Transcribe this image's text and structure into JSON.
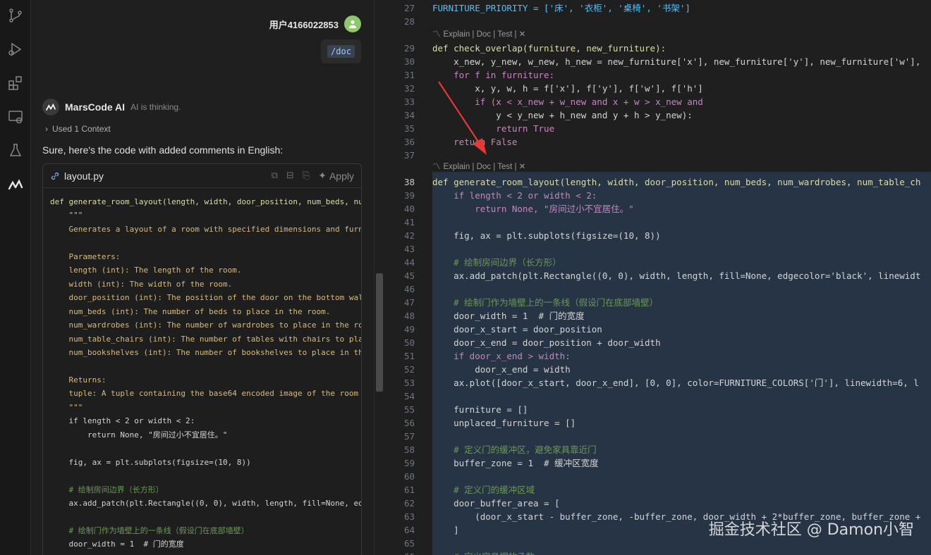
{
  "chat": {
    "user_name": "用户4166022853",
    "command": "/doc",
    "ai_name": "MarsCode AI",
    "ai_status": "AI is thinking.",
    "context_label": "Used 1 Context",
    "intro_text": "Sure, here's the code with added comments in English:",
    "code_card": {
      "file_name": "layout.py",
      "apply_label": "Apply",
      "lines": [
        "def generate_room_layout(length, width, door_position, num_beds, nu",
        "    \"\"\"",
        "    Generates a layout of a room with specified dimensions and furn",
        "",
        "    Parameters:",
        "    length (int): The length of the room.",
        "    width (int): The width of the room.",
        "    door_position (int): The position of the door on the bottom wal",
        "    num_beds (int): The number of beds to place in the room.",
        "    num_wardrobes (int): The number of wardrobes to place in the ro",
        "    num_table_chairs (int): The number of tables with chairs to pla",
        "    num_bookshelves (int): The number of bookshelves to place in th",
        "",
        "    Returns:",
        "    tuple: A tuple containing the base64 encoded image of the room",
        "    \"\"\"",
        "    if length < 2 or width < 2:",
        "        return None, \"房间过小不宜居住。\"",
        "",
        "    fig, ax = plt.subplots(figsize=(10, 8))",
        "",
        "    # 绘制房间边界（长方形）",
        "    ax.add_patch(plt.Rectangle((0, 0), width, length, fill=None, ed",
        "",
        "    # 绘制门作为墙壁上的一条线（假设门在底部墙壁）",
        "    door_width = 1  # 门的宽度"
      ]
    }
  },
  "editor": {
    "lens_label": "Explain | Doc | Test | ✕",
    "lines": [
      {
        "n": "27",
        "text": "FURNITURE_PRIORITY = ['床', '衣柜', '桌椅', '书架']"
      },
      {
        "n": "28",
        "text": ""
      },
      {
        "n": "29",
        "text": "def check_overlap(furniture, new_furniture):"
      },
      {
        "n": "30",
        "text": "    x_new, y_new, w_new, h_new = new_furniture['x'], new_furniture['y'], new_furniture['w'],"
      },
      {
        "n": "31",
        "text": "    for f in furniture:"
      },
      {
        "n": "32",
        "text": "        x, y, w, h = f['x'], f['y'], f['w'], f['h']"
      },
      {
        "n": "33",
        "text": "        if (x < x_new + w_new and x + w > x_new and"
      },
      {
        "n": "34",
        "text": "            y < y_new + h_new and y + h > y_new):"
      },
      {
        "n": "35",
        "text": "            return True"
      },
      {
        "n": "36",
        "text": "    return False"
      },
      {
        "n": "37",
        "text": ""
      },
      {
        "n": "38",
        "text": "def generate_room_layout(length, width, door_position, num_beds, num_wardrobes, num_table_ch"
      },
      {
        "n": "39",
        "text": "    if length < 2 or width < 2:"
      },
      {
        "n": "40",
        "text": "        return None, \"房间过小不宜居住。\""
      },
      {
        "n": "41",
        "text": ""
      },
      {
        "n": "42",
        "text": "    fig, ax = plt.subplots(figsize=(10, 8))"
      },
      {
        "n": "43",
        "text": ""
      },
      {
        "n": "44",
        "text": "    # 绘制房间边界（长方形）"
      },
      {
        "n": "45",
        "text": "    ax.add_patch(plt.Rectangle((0, 0), width, length, fill=None, edgecolor='black', linewidt"
      },
      {
        "n": "46",
        "text": ""
      },
      {
        "n": "47",
        "text": "    # 绘制门作为墙壁上的一条线（假设门在底部墙壁）"
      },
      {
        "n": "48",
        "text": "    door_width = 1  # 门的宽度"
      },
      {
        "n": "49",
        "text": "    door_x_start = door_position"
      },
      {
        "n": "50",
        "text": "    door_x_end = door_position + door_width"
      },
      {
        "n": "51",
        "text": "    if door_x_end > width:"
      },
      {
        "n": "52",
        "text": "        door_x_end = width"
      },
      {
        "n": "53",
        "text": "    ax.plot([door_x_start, door_x_end], [0, 0], color=FURNITURE_COLORS['门'], linewidth=6, l"
      },
      {
        "n": "54",
        "text": ""
      },
      {
        "n": "55",
        "text": "    furniture = []"
      },
      {
        "n": "56",
        "text": "    unplaced_furniture = []"
      },
      {
        "n": "57",
        "text": ""
      },
      {
        "n": "58",
        "text": "    # 定义门的缓冲区，避免家具靠近门"
      },
      {
        "n": "59",
        "text": "    buffer_zone = 1  # 缓冲区宽度"
      },
      {
        "n": "60",
        "text": ""
      },
      {
        "n": "61",
        "text": "    # 定义门的缓冲区域"
      },
      {
        "n": "62",
        "text": "    door_buffer_area = ["
      },
      {
        "n": "63",
        "text": "        (door_x_start - buffer_zone, -buffer_zone, door_width + 2*buffer_zone, buffer_zone +"
      },
      {
        "n": "64",
        "text": "    ]"
      },
      {
        "n": "65",
        "text": ""
      },
      {
        "n": "66",
        "text": "    # 定义家具摆放函数"
      }
    ]
  },
  "watermark": "掘金技术社区 @ Damon小智",
  "colors": {
    "background": "#1f1f1f",
    "selection": "#263445",
    "accent_arrow": "#e53935",
    "avatar": "#8fc76b"
  }
}
